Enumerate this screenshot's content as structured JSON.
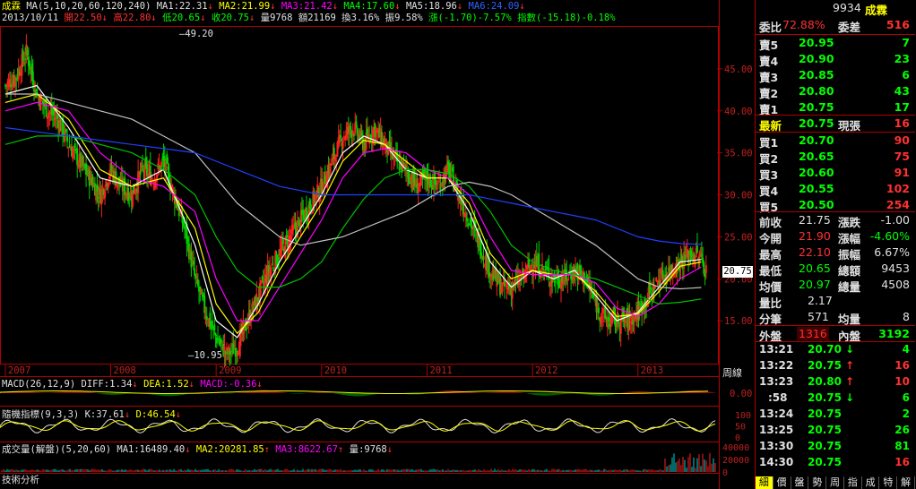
{
  "header": {
    "stock": "成霖",
    "ma_label": "MA(5,10,20,60,120,240)",
    "ma1": "MA1:22.31",
    "ma2": "MA2:21.99",
    "ma3": "MA3:21.42",
    "ma4": "MA4:17.60",
    "ma5": "MA5:18.96",
    "ma6": "MA6:24.09",
    "date": "2013/10/11",
    "open": "開22.50",
    "high": "高22.80",
    "low": "低20.65",
    "close": "收20.75",
    "vol": "量9768",
    "amount": "額21169",
    "turnover": "換3.16%",
    "amplitude": "振9.58%",
    "change": "漲(-1.70)-7.57%",
    "index": "指數(-15.18)-0.18%"
  },
  "price_labels": {
    "max_label": "49.20",
    "min_label": "10.95",
    "current": "20.75"
  },
  "cycle_label": "周線",
  "macd": {
    "title": "MACD(26,12,9)",
    "diff": "DIFF:1.34",
    "dea": "DEA:1.52",
    "macd": "MACD:-0.36"
  },
  "kd": {
    "title": "隨機指標(9,3,3)",
    "k": "K:37.61",
    "d": "D:46.54"
  },
  "volume": {
    "title": "成交量(解盤)(5,20,60)",
    "ma1": "MA1:16489.40",
    "ma2": "MA2:20281.85",
    "ma3": "MA3:8622.67",
    "vol": "量:9768"
  },
  "bottom_label": "技術分析",
  "chart_data": {
    "type": "candlestick",
    "title": "成霖",
    "x_ticks": [
      "2007",
      "2008",
      "2009",
      "2010",
      "2011",
      "2012",
      "2013"
    ],
    "y_ticks": [
      "45.00",
      "40.00",
      "35.00",
      "30.00",
      "25.00",
      "20.00",
      "15.00"
    ],
    "ylim": [
      10,
      50
    ],
    "macd_ticks": [
      "0.00"
    ],
    "kd_ticks": [
      "100",
      "50",
      "0"
    ],
    "vol_ticks": [
      "40000",
      "20000",
      "0"
    ],
    "series_close": [
      [
        2007.0,
        43
      ],
      [
        2007.1,
        44
      ],
      [
        2007.2,
        47
      ],
      [
        2007.3,
        42
      ],
      [
        2007.4,
        40
      ],
      [
        2007.5,
        39
      ],
      [
        2007.6,
        36
      ],
      [
        2007.7,
        34
      ],
      [
        2007.8,
        32
      ],
      [
        2007.9,
        30
      ],
      [
        2008.0,
        33
      ],
      [
        2008.1,
        31
      ],
      [
        2008.2,
        30
      ],
      [
        2008.3,
        33
      ],
      [
        2008.4,
        32
      ],
      [
        2008.5,
        34
      ],
      [
        2008.6,
        30
      ],
      [
        2008.7,
        26
      ],
      [
        2008.8,
        20
      ],
      [
        2008.9,
        16
      ],
      [
        2009.0,
        13
      ],
      [
        2009.1,
        11
      ],
      [
        2009.2,
        12
      ],
      [
        2009.3,
        15
      ],
      [
        2009.4,
        18
      ],
      [
        2009.5,
        21
      ],
      [
        2009.6,
        23
      ],
      [
        2009.7,
        25
      ],
      [
        2009.8,
        27
      ],
      [
        2009.9,
        29
      ],
      [
        2010.0,
        31
      ],
      [
        2010.1,
        34
      ],
      [
        2010.2,
        37
      ],
      [
        2010.3,
        38
      ],
      [
        2010.4,
        36
      ],
      [
        2010.5,
        38
      ],
      [
        2010.6,
        36
      ],
      [
        2010.7,
        34
      ],
      [
        2010.8,
        33
      ],
      [
        2010.9,
        31
      ],
      [
        2011.0,
        32
      ],
      [
        2011.1,
        31
      ],
      [
        2011.2,
        33
      ],
      [
        2011.3,
        30
      ],
      [
        2011.4,
        27
      ],
      [
        2011.5,
        24
      ],
      [
        2011.6,
        21
      ],
      [
        2011.7,
        19
      ],
      [
        2011.8,
        19
      ],
      [
        2011.9,
        20
      ],
      [
        2012.0,
        22
      ],
      [
        2012.1,
        21
      ],
      [
        2012.2,
        20
      ],
      [
        2012.3,
        20
      ],
      [
        2012.4,
        21
      ],
      [
        2012.5,
        20
      ],
      [
        2012.6,
        17
      ],
      [
        2012.7,
        15
      ],
      [
        2012.8,
        15
      ],
      [
        2012.9,
        15
      ],
      [
        2013.0,
        16
      ],
      [
        2013.1,
        18
      ],
      [
        2013.2,
        20
      ],
      [
        2013.3,
        21
      ],
      [
        2013.4,
        22
      ],
      [
        2013.5,
        23
      ],
      [
        2013.6,
        22.5
      ],
      [
        2013.65,
        20.75
      ]
    ],
    "ma_series": [
      {
        "name": "MA1",
        "color": "#ffffff",
        "values": [
          [
            2007.0,
            42
          ],
          [
            2007.3,
            43
          ],
          [
            2007.6,
            38
          ],
          [
            2007.9,
            32
          ],
          [
            2008.2,
            31
          ],
          [
            2008.5,
            33
          ],
          [
            2008.8,
            24
          ],
          [
            2009.0,
            15
          ],
          [
            2009.2,
            13
          ],
          [
            2009.4,
            17
          ],
          [
            2009.6,
            22
          ],
          [
            2009.8,
            26
          ],
          [
            2010.0,
            30
          ],
          [
            2010.2,
            35
          ],
          [
            2010.4,
            37
          ],
          [
            2010.6,
            36
          ],
          [
            2010.8,
            33
          ],
          [
            2011.0,
            32
          ],
          [
            2011.2,
            32
          ],
          [
            2011.4,
            28
          ],
          [
            2011.6,
            22
          ],
          [
            2011.8,
            19
          ],
          [
            2012.0,
            21
          ],
          [
            2012.2,
            20
          ],
          [
            2012.4,
            21
          ],
          [
            2012.6,
            18
          ],
          [
            2012.8,
            15
          ],
          [
            2013.0,
            16
          ],
          [
            2013.2,
            19
          ],
          [
            2013.4,
            22
          ],
          [
            2013.6,
            22.3
          ]
        ]
      },
      {
        "name": "MA2",
        "color": "#ffff00",
        "values": [
          [
            2007.0,
            41
          ],
          [
            2007.3,
            42
          ],
          [
            2007.6,
            39
          ],
          [
            2007.9,
            33
          ],
          [
            2008.2,
            31
          ],
          [
            2008.5,
            32
          ],
          [
            2008.8,
            26
          ],
          [
            2009.0,
            17
          ],
          [
            2009.2,
            13.5
          ],
          [
            2009.4,
            16
          ],
          [
            2009.6,
            21
          ],
          [
            2009.8,
            25
          ],
          [
            2010.0,
            29
          ],
          [
            2010.2,
            34
          ],
          [
            2010.4,
            36.5
          ],
          [
            2010.6,
            36
          ],
          [
            2010.8,
            34
          ],
          [
            2011.0,
            32
          ],
          [
            2011.2,
            32
          ],
          [
            2011.4,
            29
          ],
          [
            2011.6,
            23
          ],
          [
            2011.8,
            20
          ],
          [
            2012.0,
            21
          ],
          [
            2012.2,
            20.5
          ],
          [
            2012.4,
            20.5
          ],
          [
            2012.6,
            18.5
          ],
          [
            2012.8,
            15.5
          ],
          [
            2013.0,
            15.8
          ],
          [
            2013.2,
            18.5
          ],
          [
            2013.4,
            21.5
          ],
          [
            2013.6,
            22
          ]
        ]
      },
      {
        "name": "MA3",
        "color": "#ff00ff",
        "values": [
          [
            2007.0,
            40
          ],
          [
            2007.3,
            41
          ],
          [
            2007.6,
            40
          ],
          [
            2007.9,
            35
          ],
          [
            2008.2,
            32
          ],
          [
            2008.5,
            31
          ],
          [
            2008.8,
            28
          ],
          [
            2009.0,
            20
          ],
          [
            2009.2,
            15
          ],
          [
            2009.4,
            15
          ],
          [
            2009.6,
            19
          ],
          [
            2009.8,
            23
          ],
          [
            2010.0,
            27
          ],
          [
            2010.2,
            32
          ],
          [
            2010.4,
            35
          ],
          [
            2010.6,
            35.5
          ],
          [
            2010.8,
            35
          ],
          [
            2011.0,
            33
          ],
          [
            2011.2,
            32
          ],
          [
            2011.4,
            30
          ],
          [
            2011.6,
            25
          ],
          [
            2011.8,
            21
          ],
          [
            2012.0,
            20.5
          ],
          [
            2012.2,
            20.5
          ],
          [
            2012.4,
            20.5
          ],
          [
            2012.6,
            19.5
          ],
          [
            2012.8,
            16.5
          ],
          [
            2013.0,
            15.5
          ],
          [
            2013.2,
            17
          ],
          [
            2013.4,
            20
          ],
          [
            2013.6,
            21.4
          ]
        ]
      },
      {
        "name": "MA4",
        "color": "#00c000",
        "values": [
          [
            2007.0,
            36
          ],
          [
            2007.3,
            37
          ],
          [
            2007.6,
            37
          ],
          [
            2007.9,
            36
          ],
          [
            2008.2,
            35
          ],
          [
            2008.5,
            33
          ],
          [
            2008.8,
            30
          ],
          [
            2009.0,
            25
          ],
          [
            2009.2,
            21
          ],
          [
            2009.4,
            19
          ],
          [
            2009.6,
            19
          ],
          [
            2009.8,
            20
          ],
          [
            2010.0,
            22
          ],
          [
            2010.2,
            26
          ],
          [
            2010.4,
            29.5
          ],
          [
            2010.6,
            32
          ],
          [
            2010.8,
            33
          ],
          [
            2011.0,
            33
          ],
          [
            2011.2,
            32.5
          ],
          [
            2011.4,
            31
          ],
          [
            2011.6,
            28
          ],
          [
            2011.8,
            24
          ],
          [
            2012.0,
            22
          ],
          [
            2012.2,
            21
          ],
          [
            2012.4,
            20.5
          ],
          [
            2012.6,
            20
          ],
          [
            2012.8,
            19
          ],
          [
            2013.0,
            18
          ],
          [
            2013.2,
            17
          ],
          [
            2013.4,
            17.2
          ],
          [
            2013.6,
            17.6
          ]
        ]
      },
      {
        "name": "MA5",
        "color": "#c0c0c0",
        "values": [
          [
            2007.0,
            42
          ],
          [
            2007.3,
            42
          ],
          [
            2007.6,
            41
          ],
          [
            2007.9,
            40
          ],
          [
            2008.2,
            39
          ],
          [
            2008.5,
            37
          ],
          [
            2008.8,
            35
          ],
          [
            2009.0,
            32
          ],
          [
            2009.2,
            29
          ],
          [
            2009.4,
            27
          ],
          [
            2009.6,
            25
          ],
          [
            2009.8,
            24
          ],
          [
            2010.0,
            24.5
          ],
          [
            2010.2,
            25
          ],
          [
            2010.4,
            26
          ],
          [
            2010.6,
            27
          ],
          [
            2010.8,
            28
          ],
          [
            2011.0,
            29.5
          ],
          [
            2011.2,
            31
          ],
          [
            2011.4,
            31.5
          ],
          [
            2011.6,
            31
          ],
          [
            2011.8,
            30
          ],
          [
            2012.0,
            28.5
          ],
          [
            2012.2,
            27
          ],
          [
            2012.4,
            25.5
          ],
          [
            2012.6,
            24
          ],
          [
            2012.8,
            22
          ],
          [
            2013.0,
            20
          ],
          [
            2013.2,
            19
          ],
          [
            2013.4,
            18.8
          ],
          [
            2013.6,
            18.96
          ]
        ]
      },
      {
        "name": "MA6",
        "color": "#2040ff",
        "values": [
          [
            2007.0,
            38
          ],
          [
            2007.3,
            37.5
          ],
          [
            2007.6,
            37
          ],
          [
            2007.9,
            36.5
          ],
          [
            2008.2,
            36
          ],
          [
            2008.5,
            35.5
          ],
          [
            2008.8,
            35
          ],
          [
            2009.0,
            34
          ],
          [
            2009.2,
            33
          ],
          [
            2009.4,
            32
          ],
          [
            2009.6,
            31
          ],
          [
            2009.8,
            30.5
          ],
          [
            2010.0,
            30
          ],
          [
            2010.2,
            30
          ],
          [
            2010.4,
            30
          ],
          [
            2010.6,
            30
          ],
          [
            2010.8,
            30
          ],
          [
            2011.0,
            30
          ],
          [
            2011.2,
            30
          ],
          [
            2011.4,
            30
          ],
          [
            2011.6,
            29.5
          ],
          [
            2011.8,
            29
          ],
          [
            2012.0,
            28.5
          ],
          [
            2012.2,
            28
          ],
          [
            2012.4,
            27.5
          ],
          [
            2012.6,
            27
          ],
          [
            2012.8,
            26
          ],
          [
            2013.0,
            25
          ],
          [
            2013.2,
            24.5
          ],
          [
            2013.4,
            24.2
          ],
          [
            2013.6,
            24.09
          ]
        ]
      }
    ]
  },
  "quote": {
    "code": "9934",
    "name": "成霖",
    "ratio_label": "委比",
    "ratio_value": "72.88%",
    "diff_label": "委差",
    "diff_value": "516",
    "asks": [
      {
        "label": "賣5",
        "price": "20.95",
        "vol": "7"
      },
      {
        "label": "賣4",
        "price": "20.90",
        "vol": "23"
      },
      {
        "label": "賣3",
        "price": "20.85",
        "vol": "6"
      },
      {
        "label": "賣2",
        "price": "20.80",
        "vol": "43"
      },
      {
        "label": "賣1",
        "price": "20.75",
        "vol": "17"
      }
    ],
    "last_label": "最新",
    "last_price": "20.75",
    "cur_label": "現張",
    "cur_vol": "16",
    "bids": [
      {
        "label": "買1",
        "price": "20.70",
        "vol": "90"
      },
      {
        "label": "買2",
        "price": "20.65",
        "vol": "75"
      },
      {
        "label": "買3",
        "price": "20.60",
        "vol": "91"
      },
      {
        "label": "買4",
        "price": "20.55",
        "vol": "102"
      },
      {
        "label": "買5",
        "price": "20.50",
        "vol": "254"
      }
    ],
    "stats": [
      {
        "l1": "前收",
        "v1": "21.75",
        "l2": "漲跌",
        "v2": "-1.00"
      },
      {
        "l1": "今開",
        "v1": "21.90",
        "l2": "漲幅",
        "v2": "-4.60%"
      },
      {
        "l1": "最高",
        "v1": "22.10",
        "l2": "振幅",
        "v2": "6.67%"
      },
      {
        "l1": "最低",
        "v1": "20.65",
        "l2": "總額",
        "v2": "9453"
      },
      {
        "l1": "均價",
        "v1": "20.97",
        "l2": "總量",
        "v2": "4508"
      }
    ],
    "volratio_label": "量比",
    "volratio_value": "2.17",
    "trades_label": "分筆",
    "trades_value": "571",
    "avgvol_label": "均量",
    "avgvol_value": "8",
    "outer_label": "外盤",
    "outer_value": "1316",
    "inner_label": "內盤",
    "inner_value": "3192",
    "ticks": [
      {
        "time": "13:21",
        "price": "20.70",
        "arrow": "↓",
        "vol": "4",
        "color": "g"
      },
      {
        "time": "13:22",
        "price": "20.75",
        "arrow": "↑",
        "vol": "16",
        "color": "r"
      },
      {
        "time": "13:23",
        "price": "20.80",
        "arrow": "↑",
        "vol": "10",
        "color": "r"
      },
      {
        "time": ":58",
        "price": "20.75",
        "arrow": "↓",
        "vol": "6",
        "color": "g"
      },
      {
        "time": "13:24",
        "price": "20.75",
        "arrow": "",
        "vol": "2",
        "color": "g"
      },
      {
        "time": "13:25",
        "price": "20.75",
        "arrow": "",
        "vol": "26",
        "color": "g"
      },
      {
        "time": "13:30",
        "price": "20.75",
        "arrow": "",
        "vol": "81",
        "color": "g"
      },
      {
        "time": "14:30",
        "price": "20.75",
        "arrow": "",
        "vol": "16",
        "color": "r"
      }
    ],
    "tabs": [
      "細",
      "價",
      "盤",
      "勢",
      "周",
      "指",
      "成",
      "特",
      "解"
    ]
  }
}
